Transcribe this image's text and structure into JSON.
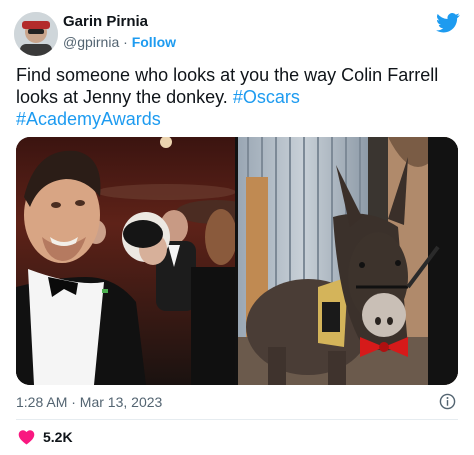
{
  "author": {
    "name": "Garin Pirnia",
    "handle": "@gpirnia",
    "separator": " · ",
    "follow_label": "Follow"
  },
  "tweet": {
    "text_parts": [
      "Find someone who looks at you the way Colin Farrell looks at Jenny the donkey. ",
      "#Oscars",
      "#AcademyAwards"
    ]
  },
  "meta": {
    "timestamp": "1:28 AM · Mar 13, 2023",
    "like_count": "5.2K"
  },
  "icons": {
    "brand": "twitter-bird-icon",
    "info": "info-icon",
    "like": "heart-icon"
  },
  "colors": {
    "link": "#1d9bf0",
    "heart": "#f91880",
    "secondary_text": "#536471"
  }
}
